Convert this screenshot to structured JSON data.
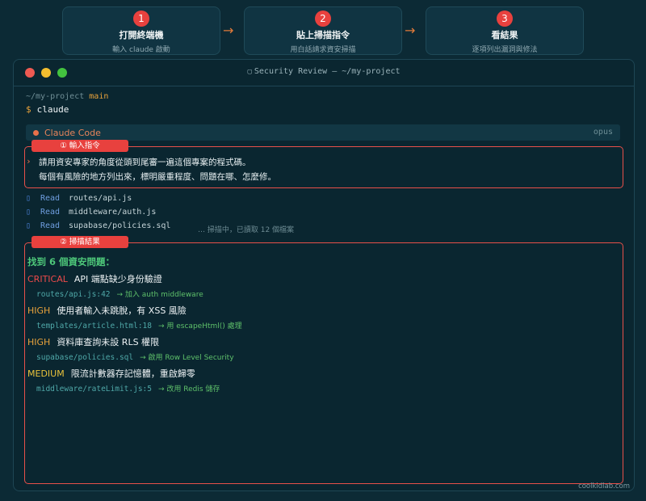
{
  "steps": [
    {
      "num": "1",
      "title": "打開終端機",
      "sub": "輸入 claude 啟動"
    },
    {
      "num": "2",
      "title": "貼上掃描指令",
      "sub": "用白話請求資安掃描"
    },
    {
      "num": "3",
      "title": "看結果",
      "sub": "逐項列出漏洞與修法"
    }
  ],
  "step_arrow": "→",
  "window": {
    "title": "Security Review — ~/my-project",
    "title_icon": "▢",
    "path": "~/my-project",
    "branch": "main",
    "prompt": "$",
    "command": "claude"
  },
  "claude_code": {
    "name": "Claude Code",
    "model": "opus"
  },
  "input_section": {
    "tag": "① 輸入指令",
    "chevron": "›",
    "lines": [
      "請用資安專家的角度從頭到尾審一遍這個專案的程式碼。",
      "每個有風險的地方列出來，標明嚴重程度、問題在哪、怎麼修。"
    ]
  },
  "reads": {
    "verb": "Read",
    "icon": "▯",
    "files": [
      "routes/api.js",
      "middleware/auth.js",
      "supabase/policies.sql"
    ],
    "status": "… 掃描中，已讀取 12 個檔案"
  },
  "results": {
    "tag": "② 掃描結果",
    "heading": "找到 6 個資安問題：",
    "issues": [
      {
        "severity": "CRITICAL",
        "title": "API 端點缺少身份驗證",
        "file": "routes/api.js:42",
        "fix": "→ 加入 auth middleware"
      },
      {
        "severity": "HIGH",
        "title": "使用者輸入未跳脫，有 XSS 風險",
        "file": "templates/article.html:18",
        "fix": "→ 用 escapeHtml() 處理"
      },
      {
        "severity": "HIGH",
        "title": "資料庫查詢未設 RLS 權限",
        "file": "supabase/policies.sql",
        "fix": "→ 啟用 Row Level Security"
      },
      {
        "severity": "MEDIUM",
        "title": "限流計數器存記憶體，重啟歸零",
        "file": "middleware/rateLimit.js:5",
        "fix": "→ 改用 Redis 儲存"
      }
    ]
  },
  "footer": "coolkidlab.com",
  "colors": {
    "accent": "#e8413e",
    "critical": "#ee4a4a",
    "high": "#e8a23b",
    "medium": "#e8c23b",
    "success": "#4ec87a"
  }
}
